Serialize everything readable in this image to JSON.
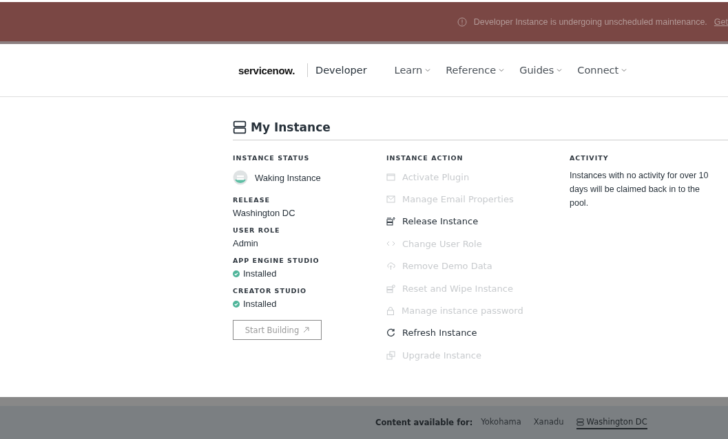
{
  "banner": {
    "message": "Developer Instance is undergoing unscheduled maintenance.",
    "link": "Get"
  },
  "header": {
    "logo": "servicenow.",
    "product": "Developer",
    "nav": [
      {
        "label": "Learn"
      },
      {
        "label": "Reference"
      },
      {
        "label": "Guides"
      },
      {
        "label": "Connect"
      }
    ]
  },
  "instance": {
    "title": "My Instance",
    "status": {
      "heading": "INSTANCE STATUS",
      "value": "Waking Instance"
    },
    "fields": [
      {
        "heading": "RELEASE",
        "value": "Washington DC",
        "kind": "plain"
      },
      {
        "heading": "USER ROLE",
        "value": "Admin",
        "kind": "plain"
      },
      {
        "heading": "APP ENGINE STUDIO",
        "value": "Installed",
        "kind": "installed"
      },
      {
        "heading": "CREATOR STUDIO",
        "value": "Installed",
        "kind": "installed"
      }
    ],
    "start_button": "Start Building",
    "actions_heading": "INSTANCE ACTION",
    "actions": [
      {
        "label": "Activate Plugin",
        "disabled": true
      },
      {
        "label": "Manage Email Properties",
        "disabled": true
      },
      {
        "label": "Release Instance",
        "disabled": false
      },
      {
        "label": "Change User Role",
        "disabled": true
      },
      {
        "label": "Remove Demo Data",
        "disabled": true
      },
      {
        "label": "Reset and Wipe Instance",
        "disabled": true
      },
      {
        "label": "Manage instance password",
        "disabled": true
      },
      {
        "label": "Refresh Instance",
        "disabled": false
      },
      {
        "label": "Upgrade Instance",
        "disabled": true
      }
    ],
    "activity": {
      "heading": "ACTIVITY",
      "text": "Instances with no activity for over 10 days will be claimed back in to the pool."
    }
  },
  "footer": {
    "label": "Content available for:",
    "versions": [
      {
        "label": "Yokohama",
        "selected": false
      },
      {
        "label": "Xanadu",
        "selected": false
      },
      {
        "label": "Washington DC",
        "selected": true
      }
    ]
  }
}
